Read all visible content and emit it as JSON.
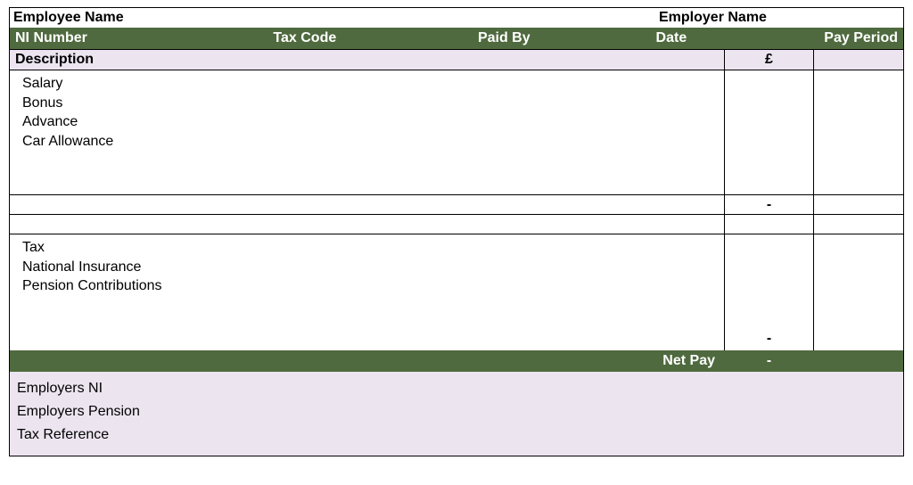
{
  "header": {
    "employee_label": "Employee Name",
    "employer_label": "Employer Name"
  },
  "greenbar": {
    "ni": "NI Number",
    "tax_code": "Tax Code",
    "paid_by": "Paid By",
    "date": "Date",
    "pay_period": "Pay Period"
  },
  "subheader": {
    "description": "Description",
    "currency": "£"
  },
  "earnings": {
    "items": [
      "Salary",
      "Bonus",
      "Advance",
      "Car Allowance"
    ],
    "total": "-"
  },
  "deductions": {
    "items": [
      "Tax",
      "National Insurance",
      "Pension Contributions"
    ],
    "total": "-"
  },
  "netpay": {
    "label": "Net Pay",
    "value": "-"
  },
  "footer": {
    "employers_ni": "Employers NI",
    "employers_pension": "Employers Pension",
    "tax_reference": "Tax Reference"
  }
}
